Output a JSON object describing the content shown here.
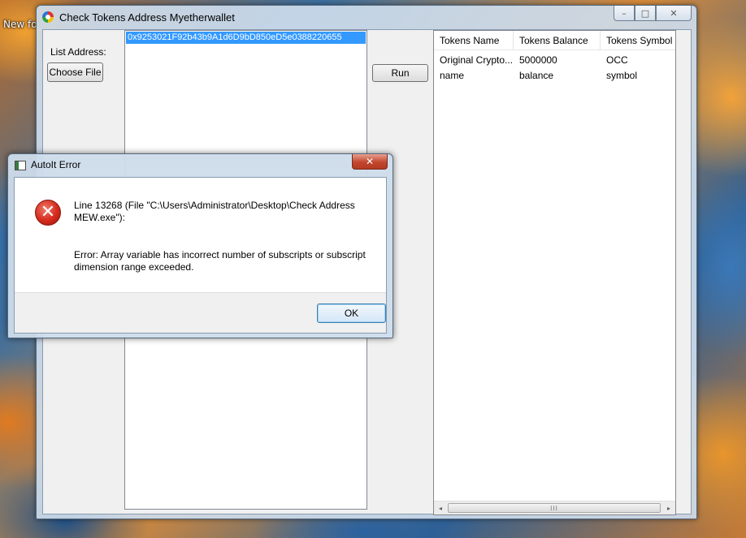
{
  "desktop": {
    "label": "New fo"
  },
  "window": {
    "title": "Check Tokens Address Myetherwallet",
    "minimize": "–",
    "maximize": "□",
    "close": "✕"
  },
  "left_panel": {
    "list_label": "List Address:",
    "choose_file_label": "Choose File",
    "run_label": "Run"
  },
  "addresses": [
    "0x9253021F92b43b9A1d6D9bD850eD5e0388220655"
  ],
  "table": {
    "columns": [
      "Tokens Name",
      "Tokens Balance",
      "Tokens Symbol"
    ],
    "rows": [
      [
        "Original Crypto...",
        "5000000",
        "OCC"
      ],
      [
        "name",
        "balance",
        "symbol"
      ]
    ],
    "scroll_left": "◂",
    "scroll_right": "▸",
    "scroll_grip": "III"
  },
  "dialog": {
    "title": "AutoIt Error",
    "close": "✕",
    "line_info": "Line 13268  (File \"C:\\Users\\Administrator\\Desktop\\Check Address MEW.exe\"):",
    "error_message": "Error: Array variable has incorrect number of subscripts or subscript dimension range exceeded.",
    "ok_label": "OK",
    "error_glyph": "✕"
  }
}
